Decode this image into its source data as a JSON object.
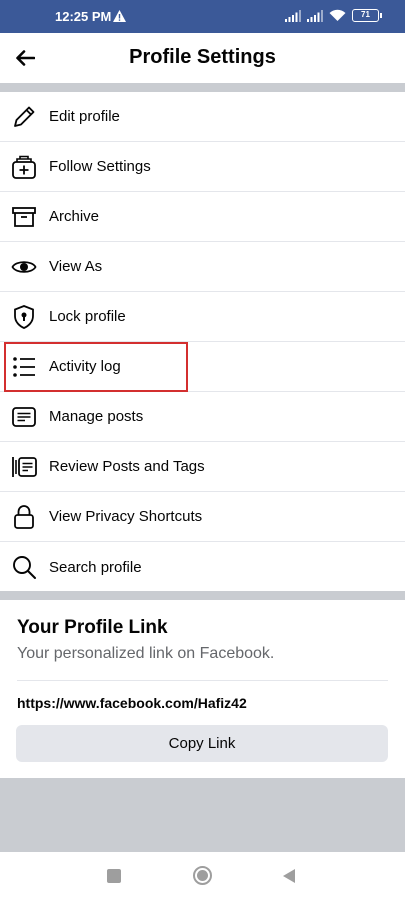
{
  "status_bar": {
    "time": "12:25 PM",
    "battery": "71"
  },
  "header": {
    "title": "Profile Settings"
  },
  "menu": {
    "items": [
      {
        "label": "Edit profile",
        "icon": "pencil-icon"
      },
      {
        "label": "Follow Settings",
        "icon": "follow-icon"
      },
      {
        "label": "Archive",
        "icon": "archive-icon"
      },
      {
        "label": "View As",
        "icon": "eye-icon"
      },
      {
        "label": "Lock profile",
        "icon": "shield-lock-icon"
      },
      {
        "label": "Activity log",
        "icon": "list-icon"
      },
      {
        "label": "Manage posts",
        "icon": "posts-icon"
      },
      {
        "label": "Review Posts and Tags",
        "icon": "review-icon"
      },
      {
        "label": "View Privacy Shortcuts",
        "icon": "lock-icon"
      },
      {
        "label": "Search profile",
        "icon": "search-icon"
      }
    ]
  },
  "profile_link": {
    "title": "Your Profile Link",
    "subtitle": "Your personalized link on Facebook.",
    "url": "https://www.facebook.com/Hafiz42",
    "copy_label": "Copy Link"
  },
  "colors": {
    "status_bar": "#3b5998",
    "highlight": "#d32f2f",
    "divider": "#c9ccd1"
  }
}
